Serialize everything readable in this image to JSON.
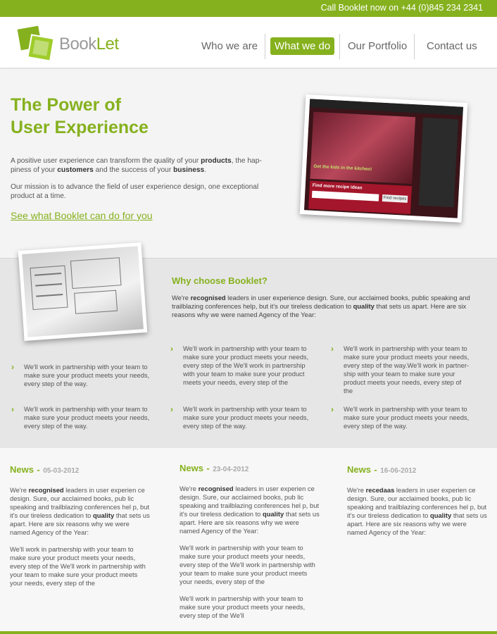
{
  "topbar": {
    "call": "Call Booklet now on +44 (0)845 234 2341"
  },
  "brand": {
    "name_part1": "Book",
    "name_part2": "Let",
    "accent": "#86b11e"
  },
  "nav": [
    {
      "label": "Who we are",
      "active": false
    },
    {
      "label": "What we do",
      "active": true
    },
    {
      "label": "Our Portfolio",
      "active": false
    },
    {
      "label": "Contact us",
      "active": false
    }
  ],
  "hero": {
    "title_line1": "The Power of",
    "title_line2": "User Experience",
    "p1_a": "A positive user experience can transform the quality of your ",
    "p1_b": "products",
    "p1_c": ", the hap-piness of your ",
    "p1_d": "customers",
    "p1_e": " and the success of your ",
    "p1_f": "business",
    "p1_g": ".",
    "p2": "Our mission is to advance the field of user experience design, one exceptional product at a time.",
    "cta": "See what Booklet can do for you",
    "screenshot": {
      "banner": "Get the kids in the kitchen!",
      "search_heading": "Find more recipe ideas",
      "search_button": "Find recipes"
    }
  },
  "why": {
    "title": "Why choose Booklet?",
    "p_a": "We're ",
    "p_b": "recognised",
    "p_c": " leaders in user experience design. Sure, our acclaimed books, public speaking and trailblazing conferences help, but it's our tireless dedication to ",
    "p_d": "quality",
    "p_e": " that sets us apart. Here are six reasons why we were named Agency of the Year:",
    "reasons": [
      "We'll work in partnership with your team to make sure your product meets your needs, every step of the way.",
      "We'll work in partnership with your team to make sure your product meets your needs, every step of the We'll work in partnership with your team to make sure your product meets your needs, every step of the",
      "We'll work in partnership with your team to make sure your product meets your needs, every step of the way.We'll work in partner-ship with your team to make sure your product meets your needs, every step of the",
      "We'll work in partnership with your team to make sure your product meets your needs, every step of the way.",
      "We'll work in partnership with your team to make sure your product meets your needs, every step of the way.",
      "We'll work in partnership with your team to make sure your product meets your needs, every step of the way."
    ]
  },
  "news": [
    {
      "label": "News",
      "date": "05-03-2012",
      "p1_a": "We're ",
      "p1_b": "recognised",
      "p1_c": " leaders in user experien ce design. Sure, our acclaimed books, pub lic speaking and trailblazing conferences hel p, but it's our tireless dedication to ",
      "p1_d": "quality",
      "p1_e": " that sets us apart. Here are six reasons why we were named Agency of the Year:",
      "p2": "We'll work in partnership with your team to make sure your product meets your needs, every step of the We'll work in partnership with your team to make sure your product meets your needs, every step of the",
      "p3": ""
    },
    {
      "label": "News",
      "date": "23-04-2012",
      "p1_a": "We're ",
      "p1_b": "recognised",
      "p1_c": " leaders in user experien ce design. Sure, our acclaimed books, pub lic speaking and trailblazing conferences hel p, but it's our tireless dedication to ",
      "p1_d": "quality",
      "p1_e": " that sets us apart. Here are six reasons why we were named Agency of the Year:",
      "p2": "We'll work in partnership with your team to make sure your product meets your needs, every step of the We'll work in partnership with your team to make sure your product meets your needs, every step of the",
      "p3": "We'll work in partnership with your team to make sure your product meets your needs, every step of the We'll"
    },
    {
      "label": "News",
      "date": "16-06-2012",
      "p1_a": "We're ",
      "p1_b": "recedaas",
      "p1_c": " leaders in user experien ce design. Sure, our acclaimed books, pub lic speaking and trailblazing conferences hel p, but it's our tireless dedication to ",
      "p1_d": "quality",
      "p1_e": " that sets us apart. Here are six reasons why we were named Agency of the Year:",
      "p2": "",
      "p3": ""
    }
  ]
}
